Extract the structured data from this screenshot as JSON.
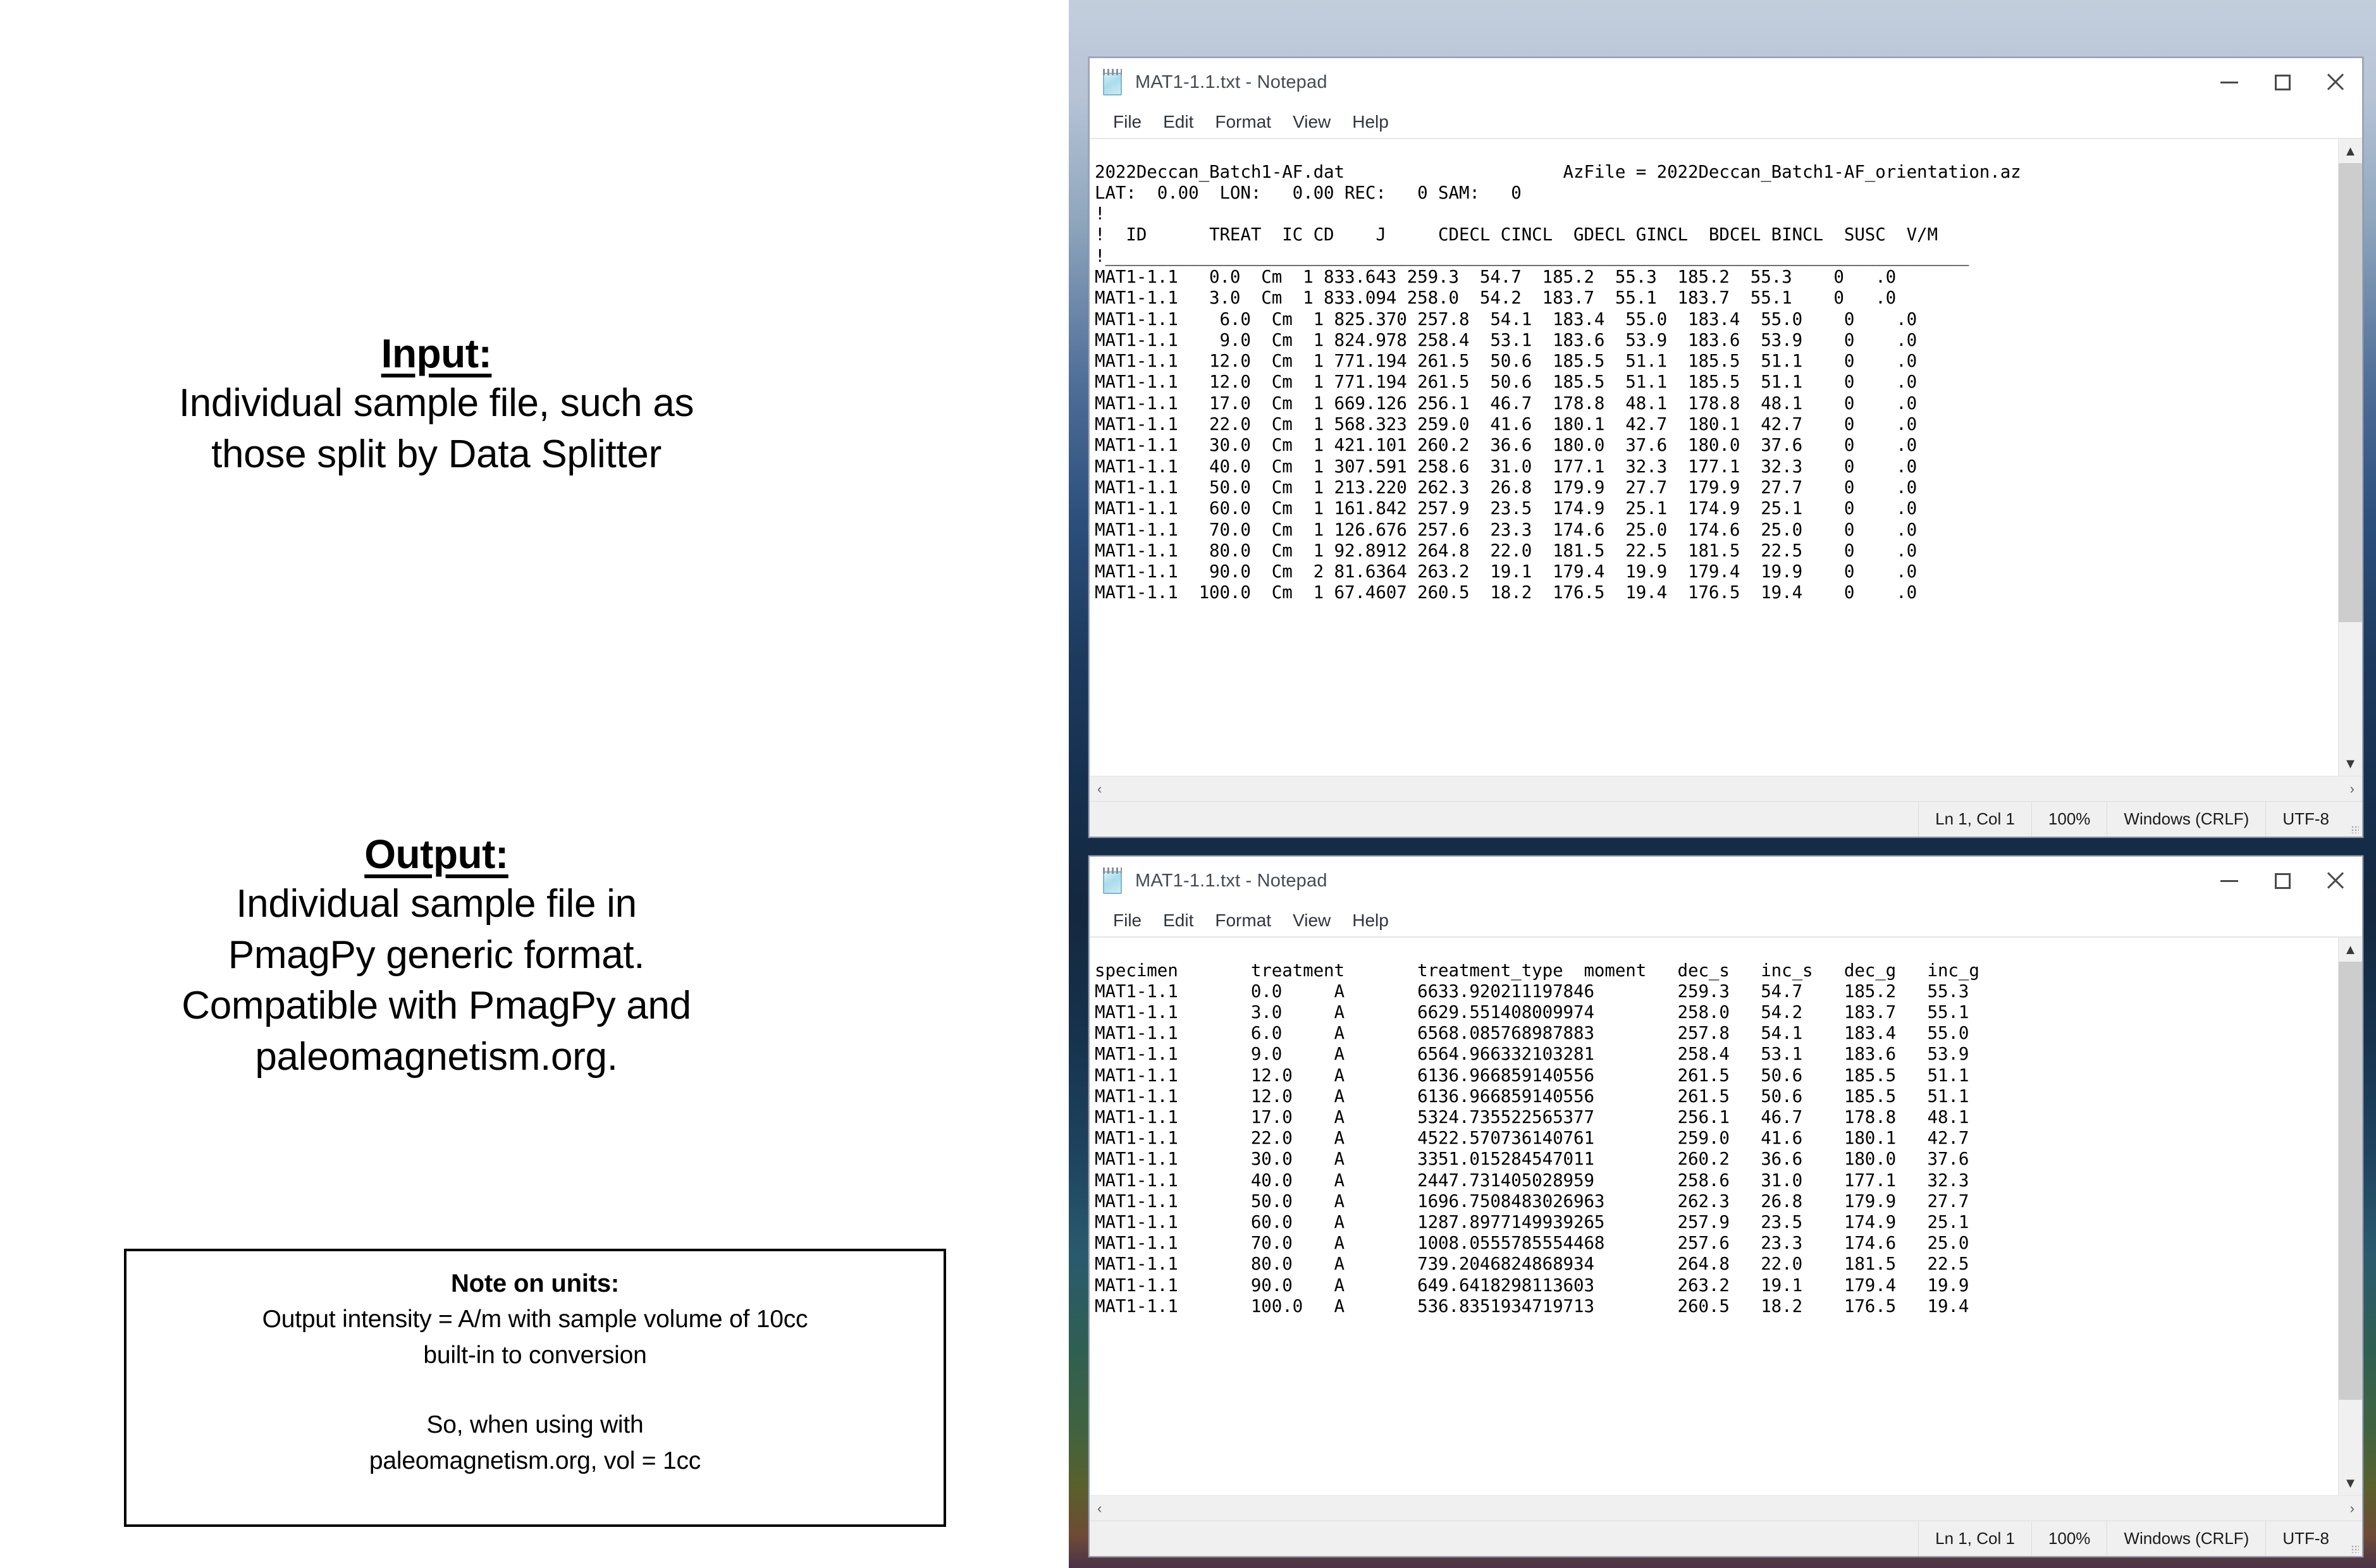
{
  "left_panel": {
    "input": {
      "heading": "Input:",
      "lines": [
        "Individual sample file, such as",
        "those split by Data Splitter"
      ]
    },
    "output": {
      "heading": "Output:",
      "lines": [
        "Individual sample file in",
        "PmagPy generic format.",
        "Compatible with PmagPy and",
        "paleomagnetism.org."
      ]
    },
    "note_box": {
      "title": "Note on units:",
      "lines": [
        "Output intensity = A/m with sample volume of 10cc",
        "built-in to conversion"
      ],
      "lines2": [
        "So, when using with",
        "paleomagnetism.org, vol = 1cc"
      ]
    }
  },
  "window1": {
    "title": "MAT1-1.1.txt - Notepad",
    "icon": "notepad-icon",
    "menu": [
      "File",
      "Edit",
      "Format",
      "View",
      "Help"
    ],
    "buttons": {
      "minimize": "minimize-button",
      "maximize": "maximize-button",
      "close": "close-button"
    },
    "content": "2022Deccan_Batch1-AF.dat                     AzFile = 2022Deccan_Batch1-AF_orientation.az\nLAT:  0.00  LON:   0.00 REC:   0 SAM:   0\n!\n!  ID      TREAT  IC CD    J     CDECL CINCL  GDECL GINCL  BDCEL BINCL  SUSC  V/M\n!___________________________________________________________________________________\nMAT1-1.1   0.0  Cm  1 833.643 259.3  54.7  185.2  55.3  185.2  55.3    0   .0\nMAT1-1.1   3.0  Cm  1 833.094 258.0  54.2  183.7  55.1  183.7  55.1    0   .0\nMAT1-1.1    6.0  Cm  1 825.370 257.8  54.1  183.4  55.0  183.4  55.0    0    .0\nMAT1-1.1    9.0  Cm  1 824.978 258.4  53.1  183.6  53.9  183.6  53.9    0    .0\nMAT1-1.1   12.0  Cm  1 771.194 261.5  50.6  185.5  51.1  185.5  51.1    0    .0\nMAT1-1.1   12.0  Cm  1 771.194 261.5  50.6  185.5  51.1  185.5  51.1    0    .0\nMAT1-1.1   17.0  Cm  1 669.126 256.1  46.7  178.8  48.1  178.8  48.1    0    .0\nMAT1-1.1   22.0  Cm  1 568.323 259.0  41.6  180.1  42.7  180.1  42.7    0    .0\nMAT1-1.1   30.0  Cm  1 421.101 260.2  36.6  180.0  37.6  180.0  37.6    0    .0\nMAT1-1.1   40.0  Cm  1 307.591 258.6  31.0  177.1  32.3  177.1  32.3    0    .0\nMAT1-1.1   50.0  Cm  1 213.220 262.3  26.8  179.9  27.7  179.9  27.7    0    .0\nMAT1-1.1   60.0  Cm  1 161.842 257.9  23.5  174.9  25.1  174.9  25.1    0    .0\nMAT1-1.1   70.0  Cm  1 126.676 257.6  23.3  174.6  25.0  174.6  25.0    0    .0\nMAT1-1.1   80.0  Cm  1 92.8912 264.8  22.0  181.5  22.5  181.5  22.5    0    .0\nMAT1-1.1   90.0  Cm  2 81.6364 263.2  19.1  179.4  19.9  179.4  19.9    0    .0\nMAT1-1.1  100.0  Cm  1 67.4607 260.5  18.2  176.5  19.4  176.5  19.4    0    .0",
    "statusbar": {
      "position": "Ln 1, Col 1",
      "zoom": "100%",
      "line_ending": "Windows (CRLF)",
      "encoding": "UTF-8"
    }
  },
  "window2": {
    "title": "MAT1-1.1.txt - Notepad",
    "icon": "notepad-icon",
    "menu": [
      "File",
      "Edit",
      "Format",
      "View",
      "Help"
    ],
    "buttons": {
      "minimize": "minimize-button",
      "maximize": "maximize-button",
      "close": "close-button"
    },
    "content": "specimen       treatment       treatment_type  moment   dec_s   inc_s   dec_g   inc_g\nMAT1-1.1       0.0     A       6633.920211197846        259.3   54.7    185.2   55.3\nMAT1-1.1       3.0     A       6629.551408009974        258.0   54.2    183.7   55.1\nMAT1-1.1       6.0     A       6568.085768987883        257.8   54.1    183.4   55.0\nMAT1-1.1       9.0     A       6564.966332103281        258.4   53.1    183.6   53.9\nMAT1-1.1       12.0    A       6136.966859140556        261.5   50.6    185.5   51.1\nMAT1-1.1       12.0    A       6136.966859140556        261.5   50.6    185.5   51.1\nMAT1-1.1       17.0    A       5324.735522565377        256.1   46.7    178.8   48.1\nMAT1-1.1       22.0    A       4522.570736140761        259.0   41.6    180.1   42.7\nMAT1-1.1       30.0    A       3351.015284547011        260.2   36.6    180.0   37.6\nMAT1-1.1       40.0    A       2447.731405028959        258.6   31.0    177.1   32.3\nMAT1-1.1       50.0    A       1696.7508483026963       262.3   26.8    179.9   27.7\nMAT1-1.1       60.0    A       1287.8977149939265       257.9   23.5    174.9   25.1\nMAT1-1.1       70.0    A       1008.0555785554468       257.6   23.3    174.6   25.0\nMAT1-1.1       80.0    A       739.2046824868934        264.8   22.0    181.5   22.5\nMAT1-1.1       90.0    A       649.6418298113603        263.2   19.1    179.4   19.9\nMAT1-1.1       100.0   A       536.8351934719713        260.5   18.2    176.5   19.4",
    "statusbar": {
      "position": "Ln 1, Col 1",
      "zoom": "100%",
      "line_ending": "Windows (CRLF)",
      "encoding": "UTF-8"
    }
  },
  "icons": {
    "scroll_up": "▲",
    "scroll_down": "▼",
    "scroll_left": "‹",
    "scroll_right": "›"
  }
}
